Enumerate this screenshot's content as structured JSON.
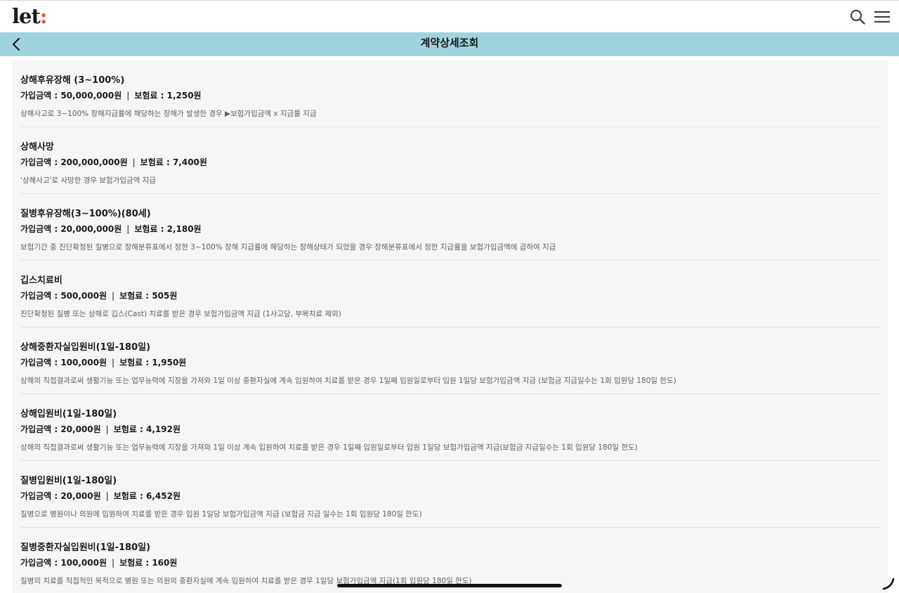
{
  "header": {
    "logo_text": "let",
    "logo_colon": ":"
  },
  "subheader": {
    "title": "계약상세조회"
  },
  "items": [
    {
      "title": "상해후유장해 (3~100%)",
      "amount_text": "가입금액 : 50,000,000원",
      "separator": "|",
      "premium_text": "보험료 : 1,250원",
      "description": "상해사고로 3~100% 장해지급률에 해당하는 장해가 발생한 경우 ▶보험가입금액 x 지급률 지급"
    },
    {
      "title": "상해사망",
      "amount_text": "가입금액 : 200,000,000원",
      "separator": "|",
      "premium_text": "보험료 : 7,400원",
      "description": "'상해사고'로 사망한 경우 보험가입금액 지급"
    },
    {
      "title": "질병후유장해(3~100%)(80세)",
      "amount_text": "가입금액 : 20,000,000원",
      "separator": "|",
      "premium_text": "보험료 : 2,180원",
      "description": "보험기간 중 진단확정된 질병으로 장해분류표에서 정한 3~100% 장해 지급률에 해당하는 장해상태가 되었을 경우 장해분류표에서 정한 지급률을 보험가입금액에 곱하여 지급"
    },
    {
      "title": "깁스치료비",
      "amount_text": "가입금액 : 500,000원",
      "separator": "|",
      "premium_text": "보험료 : 505원",
      "description": "진단확정된 질병 또는 상해로 깁스(Cast) 치료를 받은 경우 보험가입금액 지급 (1사고당, 부목치료 제외)"
    },
    {
      "title": "상해중환자실입원비(1일-180일)",
      "amount_text": "가입금액 : 100,000원",
      "separator": "|",
      "premium_text": "보험료 : 1,950원",
      "description": "상해의 직접결과로써 생활기능 또는 업무능력에 지장을 가져와 1일 이상 중환자실에 계속 입원하여 치료를 받은 경우 1일째 입원일로부터 입원 1일당 보험가입금액 지급 (보험금 지급일수는 1회 입원당 180일 한도)"
    },
    {
      "title": "상해입원비(1일-180일)",
      "amount_text": "가입금액 : 20,000원",
      "separator": "|",
      "premium_text": "보험료 : 4,192원",
      "description": "상해의 직접결과로써 생활기능 또는 업무능력에 지장을 가져와 1일 이상 계속 입원하여 치료를 받은 경우 1일째 입원일로부터 입원 1일당 보험가입금액 지급(보험금 지급일수는 1회 입원당 180일 한도)"
    },
    {
      "title": "질병입원비(1일-180일)",
      "amount_text": "가입금액 : 20,000원",
      "separator": "|",
      "premium_text": "보험료 : 6,452원",
      "description": "질병으로 병원이나 의원에 입원하여 치료를 받은 경우 입원 1일당 보험가입금액 지급 (보험금 지급 일수는 1회 입원당 180일 한도)"
    },
    {
      "title": "질병중환자실입원비(1일-180일)",
      "amount_text": "가입금액 : 100,000원",
      "separator": "|",
      "premium_text": "보험료 : 160원",
      "description": "질병의 치료를 직접적인 목적으로 병원 또는 의원의 중환자실에 계속 입원하여 치료를 받은 경우 1일당 보험가입금액 지급(1회 입원당 180일 한도)"
    }
  ],
  "icons": {
    "search": "search-icon",
    "menu": "hamburger-menu-icon",
    "back": "chevron-left-icon",
    "resize": "resize-handle-icon"
  },
  "colors": {
    "subheader_bg": "#9fd3de",
    "logo_colon": "#e5532d",
    "content_bg": "#f6f6f6"
  }
}
